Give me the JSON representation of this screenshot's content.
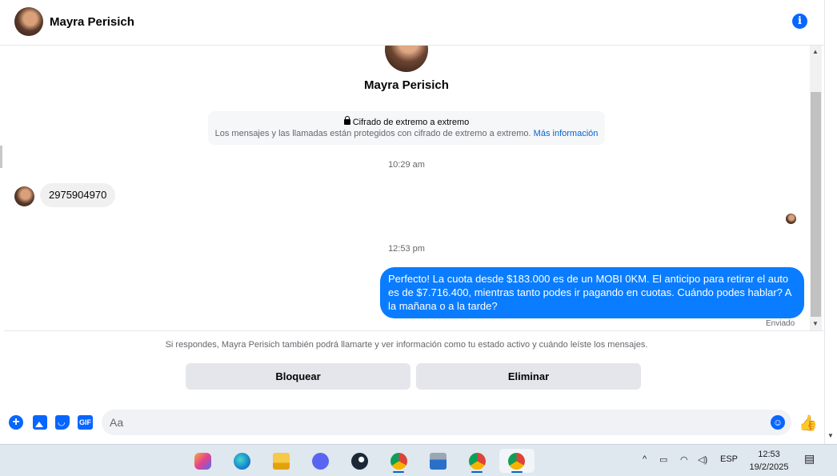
{
  "header": {
    "contact_name": "Mayra Perisich",
    "info_icon_glyph": "i"
  },
  "profile": {
    "name": "Mayra Perisich"
  },
  "encryption": {
    "title": "Cifrado de extremo a extremo",
    "description": "Los mensajes y las llamadas están protegidos con cifrado de extremo a extremo.",
    "link": "Más información"
  },
  "messages": {
    "time_1": "10:29 am",
    "incoming_1": "2975904970",
    "time_2": "12:53 pm",
    "outgoing_1": "Perfecto! La cuota desde $183.000 es de un MOBI 0KM. El anticipo para retirar el auto es de $7.716.400, mientras tanto podes ir pagando en cuotas. Cuándo podes hablar? A la mañana o a la tarde?",
    "status": "Enviado"
  },
  "request": {
    "notice": "Si respondes, Mayra Perisich también podrá llamarte y ver información como tu estado activo y cuándo leíste los mensajes.",
    "block_label": "Bloquear",
    "delete_label": "Eliminar"
  },
  "composer": {
    "placeholder": "Aa",
    "plus_glyph": "+",
    "gif_label": "GIF",
    "emoji_glyph": "☺",
    "like_glyph": "👍"
  },
  "taskbar": {
    "apps": [
      "copilot-icon",
      "edge-icon",
      "file-explorer-icon",
      "discord-icon",
      "steam-icon",
      "chrome-icon",
      "network-utility-icon",
      "chrome-icon",
      "chrome-icon"
    ],
    "language": "ESP",
    "time": "12:53",
    "date": "19/2/2025",
    "tray_chevron": "^",
    "notification_glyph": "▤"
  },
  "colors": {
    "accent": "#0866ff",
    "outgoing_bubble": "#0a7cff",
    "incoming_bubble": "#f0f0f0",
    "taskbar": "#dfe7ef"
  }
}
